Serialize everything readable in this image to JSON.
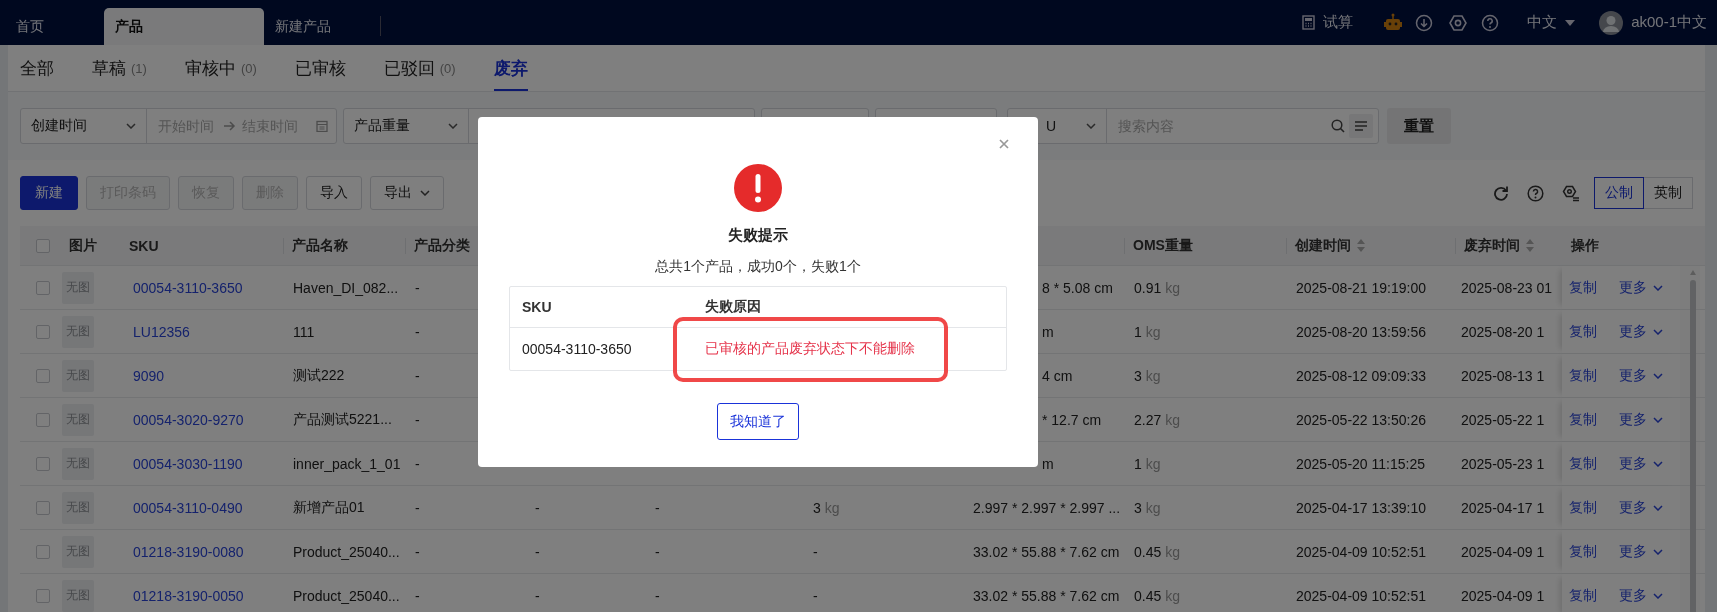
{
  "top_bar": {
    "tabs": [
      {
        "label": "首页",
        "selected": false
      },
      {
        "label": "产品",
        "selected": true
      },
      {
        "label": "新建产品",
        "selected": false
      }
    ],
    "calc_label": "试算",
    "language": "中文",
    "user": "ak00-1中文"
  },
  "status_tabs": [
    {
      "label": "全部",
      "selected": false
    },
    {
      "label": "草稿",
      "count": "(1)",
      "selected": false
    },
    {
      "label": "审核中",
      "count": "(0)",
      "selected": false
    },
    {
      "label": "已审核",
      "selected": false
    },
    {
      "label": "已驳回",
      "count": "(0)",
      "selected": false
    },
    {
      "label": "废弃",
      "selected": true
    }
  ],
  "filters": {
    "date_field": "创建时间",
    "start_placeholder": "开始时间",
    "end_placeholder": "结束时间",
    "weight_field": "产品重量",
    "search_field": "U",
    "search_placeholder": "搜索内容",
    "reset": "重置"
  },
  "toolbar": {
    "buttons": [
      {
        "label": "新建",
        "kind": "primary",
        "disabled": false
      },
      {
        "label": "打印条码",
        "kind": "default",
        "disabled": true
      },
      {
        "label": "恢复",
        "kind": "default",
        "disabled": true
      },
      {
        "label": "删除",
        "kind": "default",
        "disabled": true
      },
      {
        "label": "导入",
        "kind": "default",
        "disabled": false
      },
      {
        "label": "导出",
        "kind": "dropdown",
        "disabled": false
      }
    ],
    "units": [
      {
        "label": "公制",
        "selected": true
      },
      {
        "label": "英制",
        "selected": false
      }
    ]
  },
  "table": {
    "header_checked": false,
    "columns": [
      {
        "label": "图片",
        "sortable": false
      },
      {
        "label": "SKU",
        "sortable": false
      },
      {
        "label": "产品名称",
        "sortable": false
      },
      {
        "label": "产品分类",
        "sortable": false
      },
      {
        "label": "OMS重量",
        "sortable": false
      },
      {
        "label": "创建时间",
        "sortable": true
      },
      {
        "label": "废弃时间",
        "sortable": true
      },
      {
        "label": "操作",
        "sortable": false
      }
    ],
    "rows": [
      {
        "checked": false,
        "image": "无图",
        "sku": "00054-3110-3650",
        "name": "Haven_DI_082...",
        "category": "-",
        "dimensions": "8 * 5.08 cm",
        "dimensions_cut": true,
        "oms_weight": "0.91",
        "oms_unit": "kg",
        "created": "2025-08-21 19:19:00",
        "discarded": "2025-08-23 01",
        "actions": [
          "复制",
          "更多"
        ]
      },
      {
        "checked": false,
        "image": "无图",
        "sku": "LU12356",
        "name": "111",
        "category": "-",
        "dimensions": "m",
        "dimensions_cut": true,
        "oms_weight": "1",
        "oms_unit": "kg",
        "created": "2025-08-20 13:59:56",
        "discarded": "2025-08-20 1",
        "actions": [
          "复制",
          "更多"
        ]
      },
      {
        "checked": false,
        "image": "无图",
        "sku": "9090",
        "name": "测试222",
        "category": "-",
        "dimensions": "4 cm",
        "dimensions_cut": true,
        "oms_weight": "3",
        "oms_unit": "kg",
        "created": "2025-08-12 09:09:33",
        "discarded": "2025-08-13 1",
        "actions": [
          "复制",
          "更多"
        ]
      },
      {
        "checked": false,
        "image": "无图",
        "sku": "00054-3020-9270",
        "name": "产品测试5221...",
        "category": "-",
        "dimensions": "* 12.7 cm",
        "dimensions_cut": true,
        "oms_weight": "2.27",
        "oms_unit": "kg",
        "created": "2025-05-22 13:50:26",
        "discarded": "2025-05-22 1",
        "actions": [
          "复制",
          "更多"
        ]
      },
      {
        "checked": false,
        "image": "无图",
        "sku": "00054-3030-1190",
        "name": "inner_pack_1_01",
        "category": "-",
        "dimensions": "m",
        "dimensions_cut": true,
        "oms_weight": "1",
        "oms_unit": "kg",
        "created": "2025-05-20 11:15:25",
        "discarded": "2025-05-23 1",
        "actions": [
          "复制",
          "更多"
        ]
      },
      {
        "checked": false,
        "image": "无图",
        "sku": "00054-3110-0490",
        "name": "新增产品01",
        "category": "-",
        "column_5": "-",
        "column_6": "-",
        "weight": "3",
        "weight_unit": "kg",
        "dimensions": "2.997 * 2.997 * 2.997 ...",
        "dimensions_cut": false,
        "oms_weight": "3",
        "oms_unit": "kg",
        "created": "2025-04-17 13:39:10",
        "discarded": "2025-04-17 1",
        "actions": [
          "复制",
          "更多"
        ]
      },
      {
        "checked": false,
        "image": "无图",
        "sku": "01218-3190-0080",
        "name": "Product_25040...",
        "category": "-",
        "column_5": "-",
        "column_6": "-",
        "weight": "-",
        "dimensions": "33.02 * 55.88 * 7.62 cm",
        "dimensions_cut": false,
        "oms_weight": "0.45",
        "oms_unit": "kg",
        "created": "2025-04-09 10:52:51",
        "discarded": "2025-04-09 1",
        "actions": [
          "复制",
          "更多"
        ]
      },
      {
        "checked": false,
        "image": "无图",
        "sku": "01218-3190-0050",
        "name": "Product_25040...",
        "category": "-",
        "column_5": "-",
        "column_6": "-",
        "weight": "-",
        "dimensions": "33.02 * 55.88 * 7.62 cm",
        "dimensions_cut": false,
        "oms_weight": "0.45",
        "oms_unit": "kg",
        "created": "2025-04-09 10:52:51",
        "discarded": "2025-04-09 1",
        "actions": [
          "复制",
          "更多"
        ]
      }
    ]
  },
  "dialog": {
    "title": "失败提示",
    "summary": "总共1个产品，成功0个，失败1个",
    "columns": [
      "SKU",
      "失败原因"
    ],
    "rows": [
      {
        "sku": "00054-3110-3650",
        "reason": "已审核的产品废弃状态下不能删除"
      }
    ],
    "confirm": "我知道了"
  }
}
